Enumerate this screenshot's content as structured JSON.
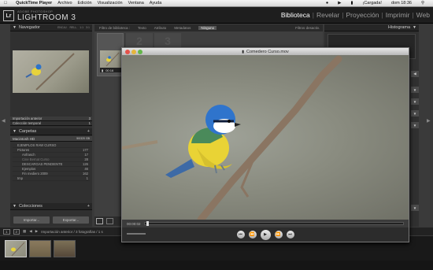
{
  "menubar": {
    "app": "QuickTime Player",
    "items": [
      "Archivo",
      "Edición",
      "Visualización",
      "Ventana",
      "Ayuda"
    ],
    "battery": "¡Cargada!",
    "clock": "dom 18:36"
  },
  "identity": {
    "logo": "Lr",
    "subtitle": "ADOBE PHOTOSHOP",
    "title": "LIGHTROOM 3",
    "modules": [
      "Biblioteca",
      "Revelar",
      "Proyección",
      "Imprimir",
      "Web"
    ],
    "active_module": "Biblioteca"
  },
  "left": {
    "navigator": "Navegador",
    "nav_zoom": [
      "ENCAJ.",
      "RELL.",
      "1:1",
      "3:1"
    ],
    "import_prev": "Importación anterior",
    "import_prev_count": "3",
    "temp_collection": "Colección temporal",
    "temp_collection_count": "1",
    "folders": "Carpetas",
    "volume": "Macintosh HD",
    "volume_size": "50/320 GB",
    "tree": [
      {
        "label": "EJEMPLOS RAW CURSO",
        "count": ""
      },
      {
        "label": "Pictures",
        "count": "177"
      },
      {
        "label": "Anfrasch",
        "count": "17"
      },
      {
        "label": "Cine Bernat Curso",
        "count": "28"
      },
      {
        "label": "DESCARGAS PENDIENTE",
        "count": "126"
      },
      {
        "label": "Ejemplos",
        "count": "46"
      },
      {
        "label": "Fin mediero 2009",
        "count": "162"
      },
      {
        "label": "tmp",
        "count": "1"
      }
    ],
    "collections": "Colecciones",
    "import_btn": "Importar...",
    "export_btn": "Exportar..."
  },
  "center": {
    "filter_label": "Filtro de biblioteca :",
    "filters": [
      "Texto",
      "Atributo",
      "Metadatos",
      "Ninguno"
    ],
    "filter_off": "Filtros desactiv.",
    "cell_time": "00:16"
  },
  "right": {
    "histogram": "Histograma"
  },
  "filmstrip": {
    "info": "Importación anterior / 3 fotografías / 1 s",
    "pages": [
      "1",
      "2"
    ]
  },
  "quicktime": {
    "title": "Comedero Curso.mov",
    "timecode": "00:00:02",
    "controls": [
      "rewind-start",
      "rewind",
      "play",
      "fast-forward",
      "forward-end"
    ]
  },
  "colors": {
    "accent": "#ffffff",
    "panel": "#303030"
  }
}
